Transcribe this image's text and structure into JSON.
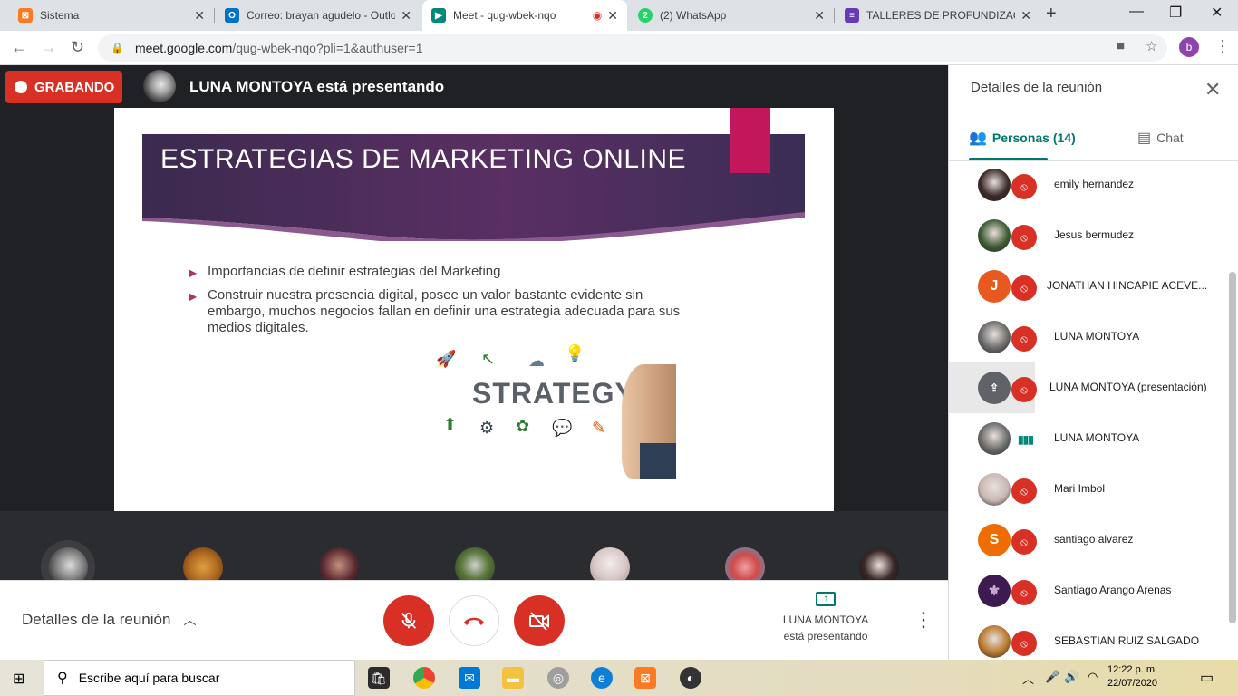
{
  "tabs": [
    {
      "title": "Sistema",
      "icon": "xampp-icon",
      "color": "#fb7a24",
      "glyph": "⊠"
    },
    {
      "title": "Correo: brayan agudelo - Outlo",
      "icon": "outlook-icon",
      "color": "#0072c6",
      "glyph": "O"
    },
    {
      "title": "Meet - qug-wbek-nqo",
      "icon": "meet-icon",
      "color": "#00897b",
      "glyph": "▶"
    },
    {
      "title": "(2) WhatsApp",
      "icon": "whatsapp-icon",
      "color": "#25d366",
      "glyph": "2"
    },
    {
      "title": "TALLERES DE PROFUNDIZACIÓ",
      "icon": "forms-icon",
      "color": "#673ab7",
      "glyph": "≡"
    }
  ],
  "address": {
    "host": "meet.google.com",
    "path": "/qug-wbek-nqo?pli=1&authuser=1"
  },
  "profile_letter": "b",
  "recording": {
    "label": "GRABANDO"
  },
  "presenting_banner": "LUNA MONTOYA está presentando",
  "slide": {
    "title": "ESTRATEGIAS DE MARKETING ONLINE",
    "bullets": [
      "Importancias de definir estrategias del Marketing",
      "Construir nuestra presencia digital, posee un valor  bastante evidente  sin embargo, muchos negocios fallan  en definir una estrategia adecuada para sus medios digitales."
    ],
    "image_word": "STRATEGY"
  },
  "bottom_bar": {
    "details_label": "Detalles de la reunión",
    "presenting_name": "LUNA MONTOYA",
    "presenting_status": "está presentando"
  },
  "panel": {
    "title": "Detalles de la reunión",
    "people_tab": "Personas (14)",
    "chat_tab": "Chat",
    "people": [
      {
        "name": "emily hernandez",
        "avatar": "photo",
        "color": "#3b2a28",
        "state": "muted"
      },
      {
        "name": "Jesus bermudez",
        "avatar": "photo",
        "color": "#3e5b34",
        "state": "muted"
      },
      {
        "name": "JONATHAN HINCAPIE ACEVE...",
        "avatar": "J",
        "color": "#e8591f",
        "state": "muted"
      },
      {
        "name": "LUNA MONTOYA",
        "avatar": "photo",
        "color": "#6b6b6b",
        "state": "muted"
      },
      {
        "name": "LUNA MONTOYA (presentación)",
        "avatar": "present",
        "color": "#5f6368",
        "state": "muted"
      },
      {
        "name": "LUNA MONTOYA",
        "avatar": "photo",
        "color": "#6b6b6b",
        "state": "speaking"
      },
      {
        "name": "Mari Imbol",
        "avatar": "photo",
        "color": "#c9b8b4",
        "state": "muted"
      },
      {
        "name": "santiago alvarez",
        "avatar": "S",
        "color": "#ef6c00",
        "state": "muted"
      },
      {
        "name": "Santiago Arango Arenas",
        "avatar": "fleur",
        "color": "#3d1b4f",
        "state": "muted"
      },
      {
        "name": "SEBASTIAN RUIZ SALGADO",
        "avatar": "photo",
        "color": "#b8782e",
        "state": "muted"
      }
    ]
  },
  "taskbar": {
    "search_placeholder": "Escribe aquí para buscar",
    "time": "12:22 p. m.",
    "date": "22/07/2020"
  }
}
